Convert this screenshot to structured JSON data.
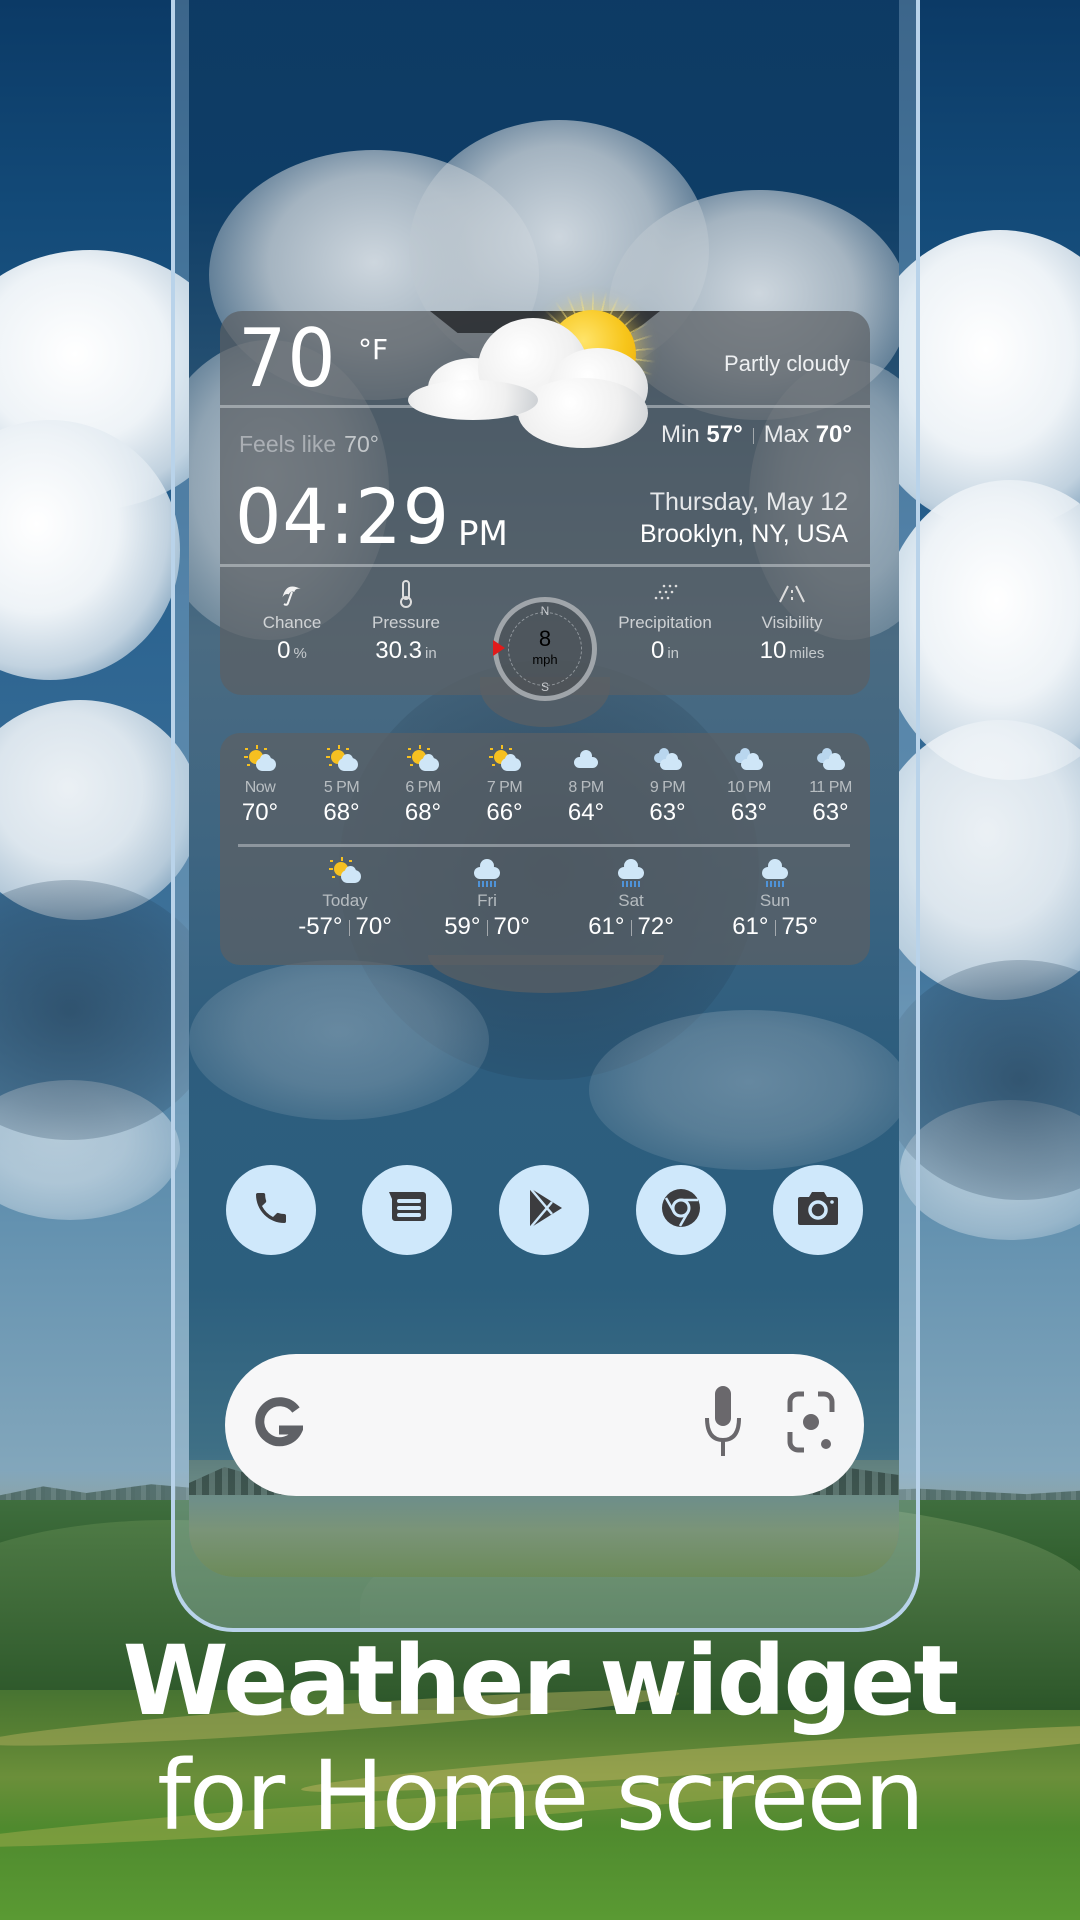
{
  "widget": {
    "temperature": "70",
    "temperature_unit": "°F",
    "condition": "Partly cloudy",
    "feels_like_label": "Feels like",
    "feels_like_value": "70°",
    "min_label": "Min",
    "min_value": "57°",
    "max_label": "Max",
    "max_value": "70°",
    "time": "04:29",
    "ampm": "PM",
    "date": "Thursday, May 12",
    "location": "Brooklyn, NY, USA",
    "details": [
      {
        "icon": "umbrella-icon",
        "label": "Chance",
        "value": "0",
        "unit": "%"
      },
      {
        "icon": "thermometer-icon",
        "label": "Pressure",
        "value": "30.3",
        "unit": "in"
      },
      {
        "icon": "precipitation-icon",
        "label": "Precipitation",
        "value": "0",
        "unit": "in"
      },
      {
        "icon": "visibility-icon",
        "label": "Visibility",
        "value": "10",
        "unit": "miles"
      }
    ],
    "wind": {
      "speed": "8",
      "unit": "mph",
      "north": "N",
      "south": "S",
      "pointer_color": "#e01b1b"
    }
  },
  "hourly": [
    {
      "label": "Now",
      "temp": "70°",
      "icon": "partly-sunny-icon"
    },
    {
      "label": "5 PM",
      "temp": "68°",
      "icon": "partly-sunny-icon"
    },
    {
      "label": "6 PM",
      "temp": "68°",
      "icon": "partly-sunny-icon"
    },
    {
      "label": "7 PM",
      "temp": "66°",
      "icon": "partly-sunny-icon"
    },
    {
      "label": "8 PM",
      "temp": "64°",
      "icon": "cloud-icon"
    },
    {
      "label": "9 PM",
      "temp": "63°",
      "icon": "clouds-icon"
    },
    {
      "label": "10 PM",
      "temp": "63°",
      "icon": "clouds-icon"
    },
    {
      "label": "11 PM",
      "temp": "63°",
      "icon": "clouds-icon"
    }
  ],
  "daily": [
    {
      "label": "Today",
      "low": "-57°",
      "high": "70°",
      "icon": "partly-sunny-icon"
    },
    {
      "label": "Fri",
      "low": "59°",
      "high": "70°",
      "icon": "rain-icon"
    },
    {
      "label": "Sat",
      "low": "61°",
      "high": "72°",
      "icon": "rain-icon"
    },
    {
      "label": "Sun",
      "low": "61°",
      "high": "75°",
      "icon": "rain-icon"
    }
  ],
  "dock": [
    {
      "name": "phone-app",
      "icon": "phone-icon"
    },
    {
      "name": "messages-app",
      "icon": "messages-icon"
    },
    {
      "name": "play-store-app",
      "icon": "play-store-icon"
    },
    {
      "name": "chrome-app",
      "icon": "chrome-icon"
    },
    {
      "name": "camera-app",
      "icon": "camera-icon"
    }
  ],
  "search": {
    "logo": "G",
    "mic": "microphone-icon",
    "lens": "lens-icon"
  },
  "colors": {
    "dock_bg": "#cfe8fb",
    "icon_fg": "#3c3c3f",
    "frame": "#b9d3ea"
  },
  "headline": {
    "line1": "Weather widget",
    "line2": "for Home screen"
  }
}
